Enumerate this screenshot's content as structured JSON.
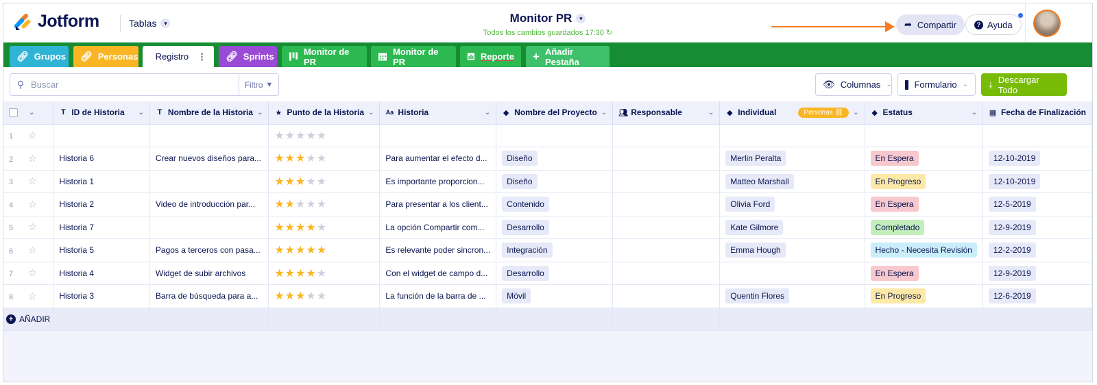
{
  "header": {
    "logo_text": "Jotform",
    "tables_label": "Tablas",
    "title": "Monitor PR",
    "saved_status": "Todos los cambios guardados 17:30",
    "share_label": "Compartir",
    "help_label": "Ayuda"
  },
  "tabs": [
    {
      "label": "Grupos",
      "color": "#30b4d5"
    },
    {
      "label": "Personas",
      "color": "#f9b523"
    },
    {
      "label": "Registro",
      "color": "#ffffff"
    },
    {
      "label": "Sprints",
      "color": "#9a4bd6"
    },
    {
      "label": "Monitor de PR",
      "color": "#2db951"
    },
    {
      "label": "Monitor de PR",
      "color": "#2db951"
    },
    {
      "label": "Reporte",
      "color": "#2db951"
    },
    {
      "label": "Añadir Pestaña",
      "color": "#3ec16a"
    }
  ],
  "toolbar": {
    "search_placeholder": "Buscar",
    "filter_label": "Filtro",
    "columns_label": "Columnas",
    "form_label": "Formulario",
    "download_label": "Descargar Todo"
  },
  "columns": [
    {
      "label": "ID de Historia",
      "icon": "text-icon"
    },
    {
      "label": "Nombre de la Historia",
      "icon": "text-icon"
    },
    {
      "label": "Punto de la Historia",
      "icon": "star-icon"
    },
    {
      "label": "Historia",
      "icon": "aa-icon"
    },
    {
      "label": "Nombre del Proyecto",
      "icon": "tag-icon"
    },
    {
      "label": "Responsable",
      "icon": "people-icon"
    },
    {
      "label": "Individual",
      "icon": "tag-icon",
      "badge": "Personas"
    },
    {
      "label": "Estatus",
      "icon": "tag-icon"
    },
    {
      "label": "Fecha de Finalización",
      "icon": "calendar-icon"
    }
  ],
  "rows": [
    {
      "num": "1",
      "id": "",
      "name": "",
      "rating": 0,
      "story": "",
      "project": "",
      "owner": "",
      "individual": "",
      "status": "",
      "status_type": "",
      "date": ""
    },
    {
      "num": "2",
      "id": "Historia 6",
      "name": "Crear nuevos diseños para...",
      "rating": 3,
      "story": "Para aumentar el efecto d...",
      "project": "Diseño",
      "owner": "",
      "individual": "Merlin Peralta",
      "status": "En Espera",
      "status_type": "espera",
      "date": "12-10-2019"
    },
    {
      "num": "3",
      "id": "Historia 1",
      "name": "",
      "rating": 3,
      "story": "Es importante proporcion...",
      "project": "Diseño",
      "owner": "",
      "individual": "Matteo Marshall",
      "status": "En Progreso",
      "status_type": "progreso",
      "date": "12-10-2019"
    },
    {
      "num": "4",
      "id": "Historia 2",
      "name": "Video de introducción par...",
      "rating": 2,
      "story": "Para presentar a los client...",
      "project": "Contenido",
      "owner": "",
      "individual": "Olivia Ford",
      "status": "En Espera",
      "status_type": "espera",
      "date": "12-5-2019"
    },
    {
      "num": "5",
      "id": "Historia 7",
      "name": "",
      "rating": 4,
      "story": "La opción Compartir com...",
      "project": "Desarrollo",
      "owner": "",
      "individual": "Kate Gilmore",
      "status": "Completado",
      "status_type": "completado",
      "date": "12-9-2019"
    },
    {
      "num": "6",
      "id": "Historia 5",
      "name": "Pagos a terceros con pasa...",
      "rating": 5,
      "story": "Es relevante poder sincron...",
      "project": "Integración",
      "owner": "",
      "individual": "Emma Hough",
      "status": "Hecho - Necesita Revisión",
      "status_type": "hecho",
      "date": "12-2-2019"
    },
    {
      "num": "7",
      "id": "Historia 4",
      "name": "Widget de subir archivos",
      "rating": 4,
      "story": "Con el widget de campo d...",
      "project": "Desarrollo",
      "owner": "",
      "individual": "",
      "status": "En Espera",
      "status_type": "espera",
      "date": "12-9-2019"
    },
    {
      "num": "8",
      "id": "Historia 3",
      "name": "Barra de búsqueda para a...",
      "rating": 3,
      "story": "La función de la barra de ...",
      "project": "Móvil",
      "owner": "",
      "individual": "Quentin Flores",
      "status": "En Progreso",
      "status_type": "progreso",
      "date": "12-6-2019"
    }
  ],
  "add_row_label": "AÑADIR"
}
